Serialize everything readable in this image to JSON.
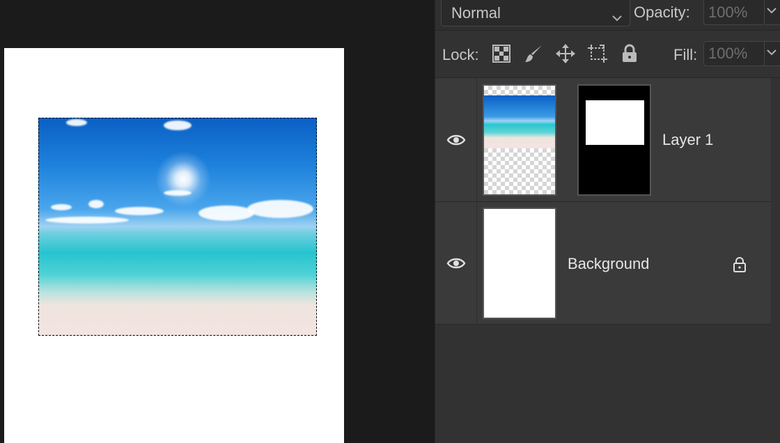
{
  "layers_panel": {
    "blend_mode": "Normal",
    "opacity_label": "Opacity:",
    "opacity_value": "100%",
    "lock_label": "Lock:",
    "fill_label": "Fill:",
    "fill_value": "100%",
    "lock_icons": [
      "transparency-lock-icon",
      "brush-lock-icon",
      "move-lock-icon",
      "artboard-lock-icon",
      "padlock-icon"
    ],
    "layers": [
      {
        "name": "Layer 1",
        "visible": true,
        "has_mask": true,
        "locked": false
      },
      {
        "name": "Background",
        "visible": true,
        "has_mask": false,
        "locked": true
      }
    ]
  },
  "canvas": {
    "selection": "marquee around beach photo"
  },
  "colors": {
    "panel_bg": "#323232",
    "workspace_bg": "#1b1b1b",
    "layer_row_bg": "#3a3a3a"
  }
}
